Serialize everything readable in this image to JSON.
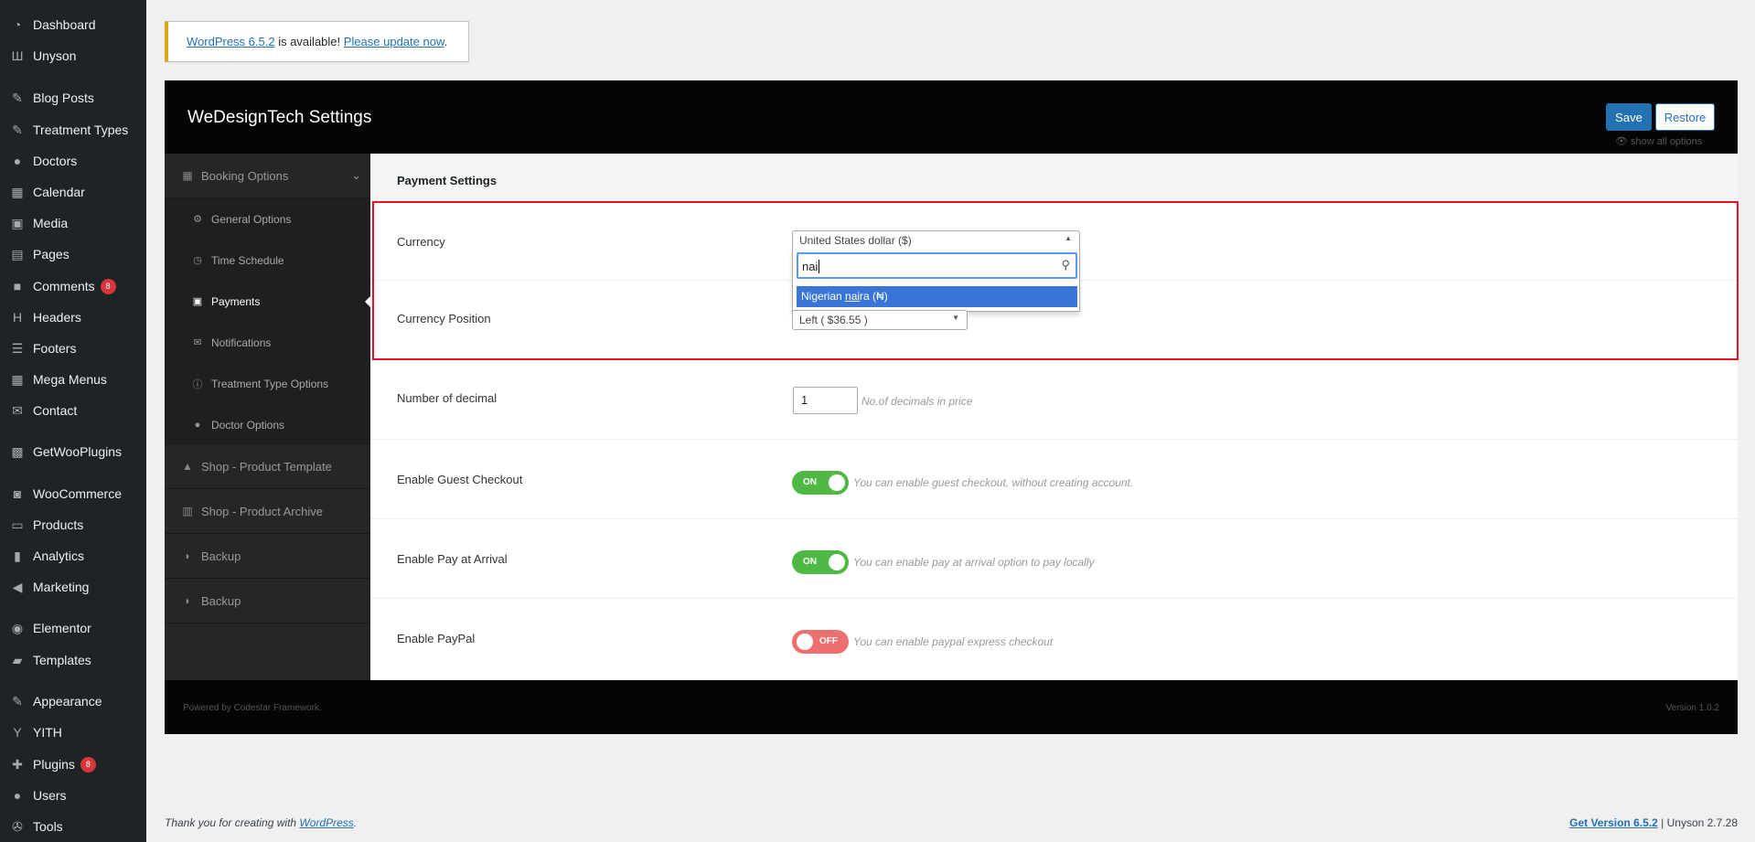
{
  "sidebar": {
    "items": [
      {
        "label": "Dashboard",
        "icon": "dashboard-icon",
        "glyph": "◔"
      },
      {
        "label": "Unyson",
        "icon": "unyson-icon",
        "glyph": "Ш"
      },
      {
        "label": "Blog Posts",
        "icon": "pin-icon",
        "glyph": "✎"
      },
      {
        "label": "Treatment Types",
        "icon": "pin-icon",
        "glyph": "✎"
      },
      {
        "label": "Doctors",
        "icon": "user-icon",
        "glyph": "●"
      },
      {
        "label": "Calendar",
        "icon": "calendar-icon",
        "glyph": "▦"
      },
      {
        "label": "Media",
        "icon": "media-icon",
        "glyph": "▣"
      },
      {
        "label": "Pages",
        "icon": "pages-icon",
        "glyph": "▤"
      },
      {
        "label": "Comments",
        "icon": "comment-icon",
        "glyph": "■",
        "badge": "8"
      },
      {
        "label": "Headers",
        "icon": "header-icon",
        "glyph": "H"
      },
      {
        "label": "Footers",
        "icon": "footer-icon",
        "glyph": "☰"
      },
      {
        "label": "Mega Menus",
        "icon": "table-icon",
        "glyph": "▦"
      },
      {
        "label": "Contact",
        "icon": "mail-icon",
        "glyph": "✉"
      },
      {
        "label": "GetWooPlugins",
        "icon": "plugins-grid-icon",
        "glyph": "▩"
      },
      {
        "label": "WooCommerce",
        "icon": "woocommerce-icon",
        "glyph": "◙"
      },
      {
        "label": "Products",
        "icon": "archive-icon",
        "glyph": "▭"
      },
      {
        "label": "Analytics",
        "icon": "bar-chart-icon",
        "glyph": "▮"
      },
      {
        "label": "Marketing",
        "icon": "megaphone-icon",
        "glyph": "◀"
      },
      {
        "label": "Elementor",
        "icon": "elementor-icon",
        "glyph": "◉"
      },
      {
        "label": "Templates",
        "icon": "folder-icon",
        "glyph": "▰"
      },
      {
        "label": "Appearance",
        "icon": "brush-icon",
        "glyph": "✎"
      },
      {
        "label": "YITH",
        "icon": "yith-icon",
        "glyph": "Y"
      },
      {
        "label": "Plugins",
        "icon": "plugin-icon",
        "glyph": "✚",
        "badge": "8"
      },
      {
        "label": "Users",
        "icon": "user-icon",
        "glyph": "●"
      },
      {
        "label": "Tools",
        "icon": "wrench-icon",
        "glyph": "✇"
      }
    ]
  },
  "notice": {
    "link1": "WordPress 6.5.2",
    "mid": " is available! ",
    "link2": "Please update now",
    "end": "."
  },
  "panel": {
    "title": "WeDesignTech Settings",
    "save": "Save",
    "restore": "Restore",
    "show_all": "👁 show all options",
    "nav": [
      {
        "label": "Booking Options",
        "glyph": "▦",
        "type": "main",
        "chevron": "⌄"
      },
      {
        "label": "General Options",
        "glyph": "⚙",
        "type": "sub"
      },
      {
        "label": "Time Schedule",
        "glyph": "◷",
        "type": "sub"
      },
      {
        "label": "Payments",
        "glyph": "▣",
        "type": "sub",
        "active": true
      },
      {
        "label": "Notifications",
        "glyph": "✉",
        "type": "sub"
      },
      {
        "label": "Treatment Type Options",
        "glyph": "ⓘ",
        "type": "sub"
      },
      {
        "label": "Doctor Options",
        "glyph": "●",
        "type": "sub"
      },
      {
        "label": "Shop - Product Template",
        "glyph": "▲",
        "type": "main"
      },
      {
        "label": "Shop - Product Archive",
        "glyph": "▥",
        "type": "main"
      },
      {
        "label": "Backup",
        "glyph": "◗",
        "type": "main"
      },
      {
        "label": "Backup",
        "glyph": "◗",
        "type": "main"
      }
    ],
    "section_title": "Payment Settings",
    "currency": {
      "label": "Currency",
      "value": "United States dollar ($)",
      "search": "nai",
      "option_pre": "Nigerian ",
      "option_match": "nai",
      "option_post": "ra (₦)"
    },
    "currency_position": {
      "label": "Currency Position",
      "value": "Left ( $36.55 )"
    },
    "decimal": {
      "label": "Number of decimal",
      "value": "1",
      "help": "No.of decimals in price"
    },
    "guest": {
      "label": "Enable Guest Checkout",
      "state": "ON",
      "help": "You can enable guest checkout, without creating account."
    },
    "arrival": {
      "label": "Enable Pay at Arrival",
      "state": "ON",
      "help": "You can enable pay at arrival option to pay locally"
    },
    "paypal": {
      "label": "Enable PayPal",
      "state": "OFF",
      "help": "You can enable paypal express checkout"
    },
    "footer_left": "Powered by Codestar Framework.",
    "footer_right": "Version 1.0.2"
  },
  "footer": {
    "thanks": "Thank you for creating with ",
    "wp_link": "WordPress",
    "thanks_end": ".",
    "get_version": "Get Version 6.5.2",
    "unyson": " | Unyson 2.7.28"
  },
  "colors": {
    "accent": "#2271b1",
    "highlight": "#e81123",
    "on": "#4fb845",
    "off": "#ed6f6f"
  }
}
